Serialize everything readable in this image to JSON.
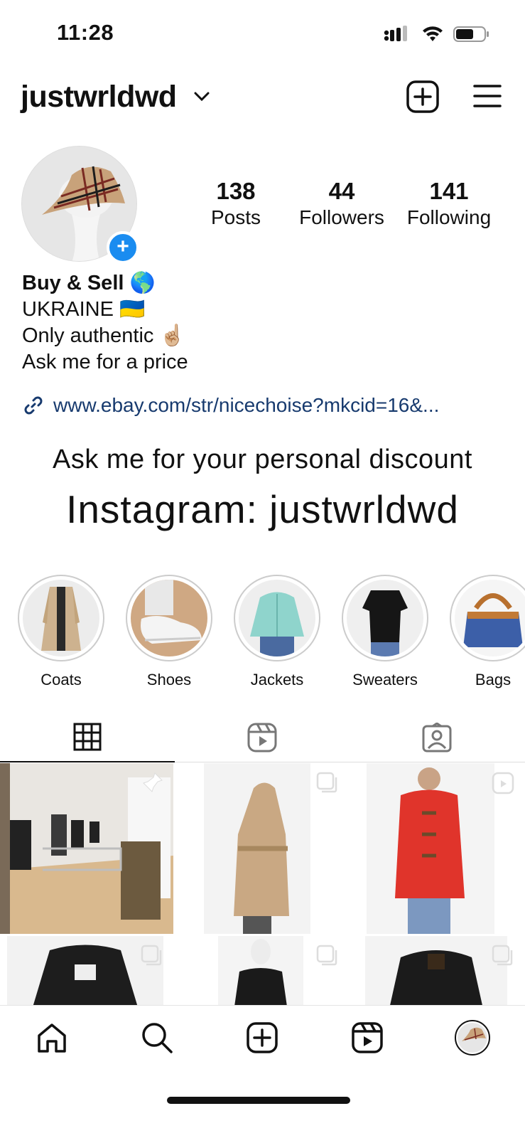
{
  "status_bar": {
    "time": "11:28"
  },
  "header": {
    "username": "justwrldwd"
  },
  "stats": [
    {
      "count": "138",
      "label": "Posts"
    },
    {
      "count": "44",
      "label": "Followers"
    },
    {
      "count": "141",
      "label": "Following"
    }
  ],
  "bio": {
    "name": "Buy & Sell 🌎",
    "lines": [
      "UKRAINE 🇺🇦",
      "Only authentic ☝🏼",
      "Ask me for a price"
    ],
    "link": "www.ebay.com/str/nicechoise?mkcid=16&..."
  },
  "promo": {
    "line1": "Ask me for your personal discount",
    "line2": "Instagram: justwrldwd"
  },
  "highlights": [
    {
      "label": "Coats"
    },
    {
      "label": "Shoes"
    },
    {
      "label": "Jackets"
    },
    {
      "label": "Sweaters"
    },
    {
      "label": "Bags"
    }
  ],
  "tabs": [
    "grid-icon",
    "reels-icon",
    "tagged-icon"
  ],
  "bottom_nav": [
    "home-icon",
    "search-icon",
    "create-icon",
    "reels-icon",
    "profile-avatar"
  ],
  "colors": {
    "accent": "#1a8cf0",
    "link": "#173a6e"
  }
}
